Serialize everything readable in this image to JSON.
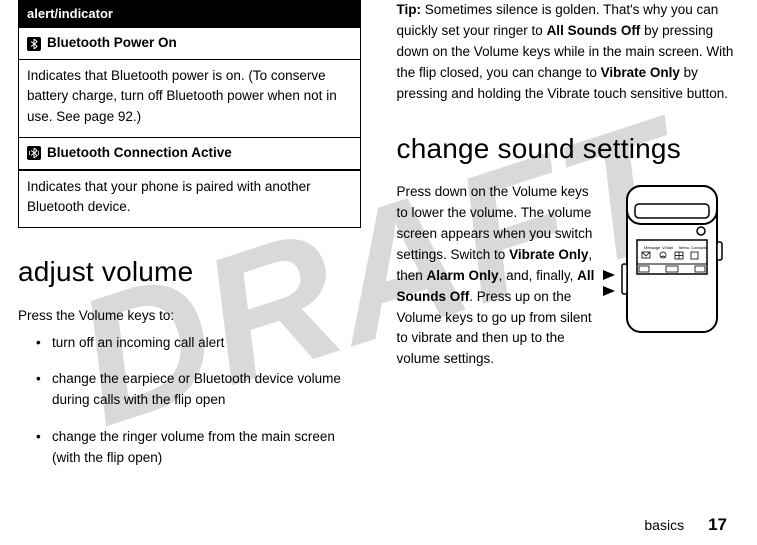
{
  "watermark": "DRAFT",
  "left": {
    "table_header": "alert/indicator",
    "row1_icon": "bluetooth-power-icon",
    "row1_title": "Bluetooth Power On",
    "row1_body": "Indicates that Bluetooth power is on. (To conserve battery charge, turn off Bluetooth power when not in use. See page 92.)",
    "row2_icon": "bluetooth-active-icon",
    "row2_title": "Bluetooth Connection Active",
    "row2_body": "Indicates that your phone is paired with another Bluetooth device.",
    "h1": "adjust volume",
    "intro": "Press the Volume keys to:",
    "bullets": [
      "turn off an incoming call alert",
      "change the earpiece or Bluetooth device volume during calls with the flip open",
      "change the ringer volume from the main screen (with the flip open)"
    ]
  },
  "right": {
    "tip_label": "Tip:",
    "tip_1": " Sometimes silence is golden. That's why you can quickly set your ringer to ",
    "tip_allsoundsoff": "All Sounds Off",
    "tip_2": " by pressing down on the Volume keys while in the main screen. With the flip closed, you can change to ",
    "tip_vibrateonly": "Vibrate Only",
    "tip_3": " by pressing and holding the Vibrate touch sensitive button.",
    "h1": "change sound settings",
    "p1_a": "Press down on the Volume keys to lower the volume. The volume screen appears when you switch settings. Switch to ",
    "p1_vibrate": "Vibrate Only",
    "p1_b": ", then ",
    "p1_alarm": "Alarm Only",
    "p1_c": ", and, finally, ",
    "p1_all": "All Sounds Off",
    "p1_d": ". Press up on the Volume keys to go up from silent to vibrate and then up to the volume settings.",
    "phone_labels": {
      "message": "Message",
      "voicemail": "V.Mail",
      "menu": "Menu",
      "contacts": "Contacts"
    }
  },
  "footer": {
    "section": "basics",
    "page": "17"
  }
}
